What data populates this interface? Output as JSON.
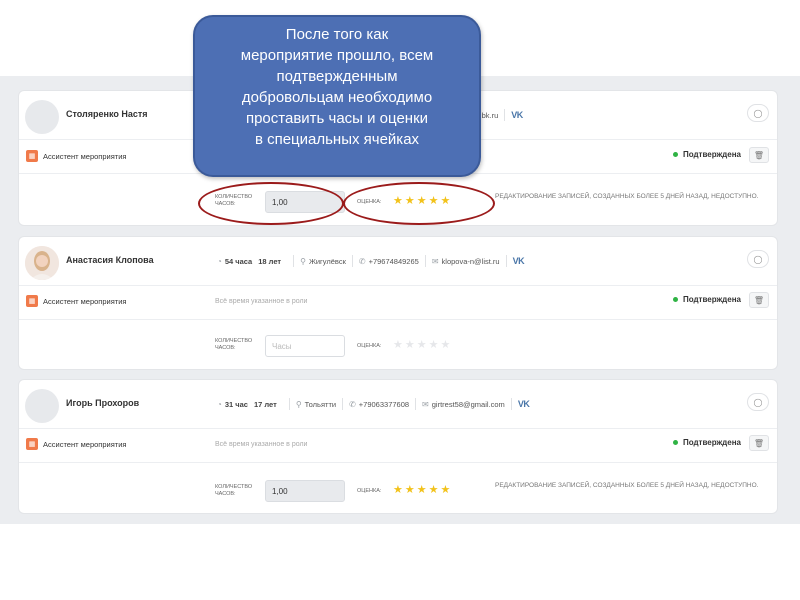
{
  "callout": {
    "text": "После того как\nмероприятие прошло, всем\nподтвержденным\nдобровольцам необходимо\nпроставить часы  и оценки\nв специальных ячейках"
  },
  "labels": {
    "hours": "КОЛИЧЕСТВО ЧАСОВ:",
    "rating": "ОЦЕНКА:",
    "hours_placeholder": "Часы",
    "hint": "Всё время указанное в роли",
    "edit_note": "РЕДАКТИРОВАНИЕ ЗАПИСЕЙ, СОЗДАННЫХ БОЛЕЕ 5 ДНЕЙ НАЗАД, НЕДОСТУПНО."
  },
  "volunteers": [
    {
      "name": "Столяренко Настя",
      "email": "@bk.ru",
      "social": "VK",
      "role": "Ассистент мероприятия",
      "status": "Подтверждена",
      "hours_value": "1,00",
      "rating": 5,
      "rating_max": 5
    },
    {
      "name": "Анастасия Клопова",
      "hours": "54 часа",
      "age": "18 лет",
      "city": "Жигулёвск",
      "phone": "+79674849265",
      "email": "klopova-n@list.ru",
      "social": "VK",
      "role": "Ассистент мероприятия",
      "hint": "Всё время указанное в роли",
      "status": "Подтверждена",
      "hours_value": "",
      "rating": 0,
      "rating_max": 5
    },
    {
      "name": "Игорь Прохоров",
      "hours": "31 час",
      "age": "17 лет",
      "city": "Тольятти",
      "phone": "+79063377608",
      "email": "girtrest58@gmail.com",
      "social": "VK",
      "role": "Ассистент мероприятия",
      "hint": "Всё время указанное в роли",
      "status": "Подтверждена",
      "hours_value": "1,00",
      "rating": 5,
      "rating_max": 5
    }
  ],
  "colors": {
    "callout_bg": "#4d6fb4",
    "highlight_ellipse": "#9b1b1b",
    "status_dot": "#2fb344",
    "star": "#f2c21a",
    "role_icon": "#f07a4a"
  }
}
